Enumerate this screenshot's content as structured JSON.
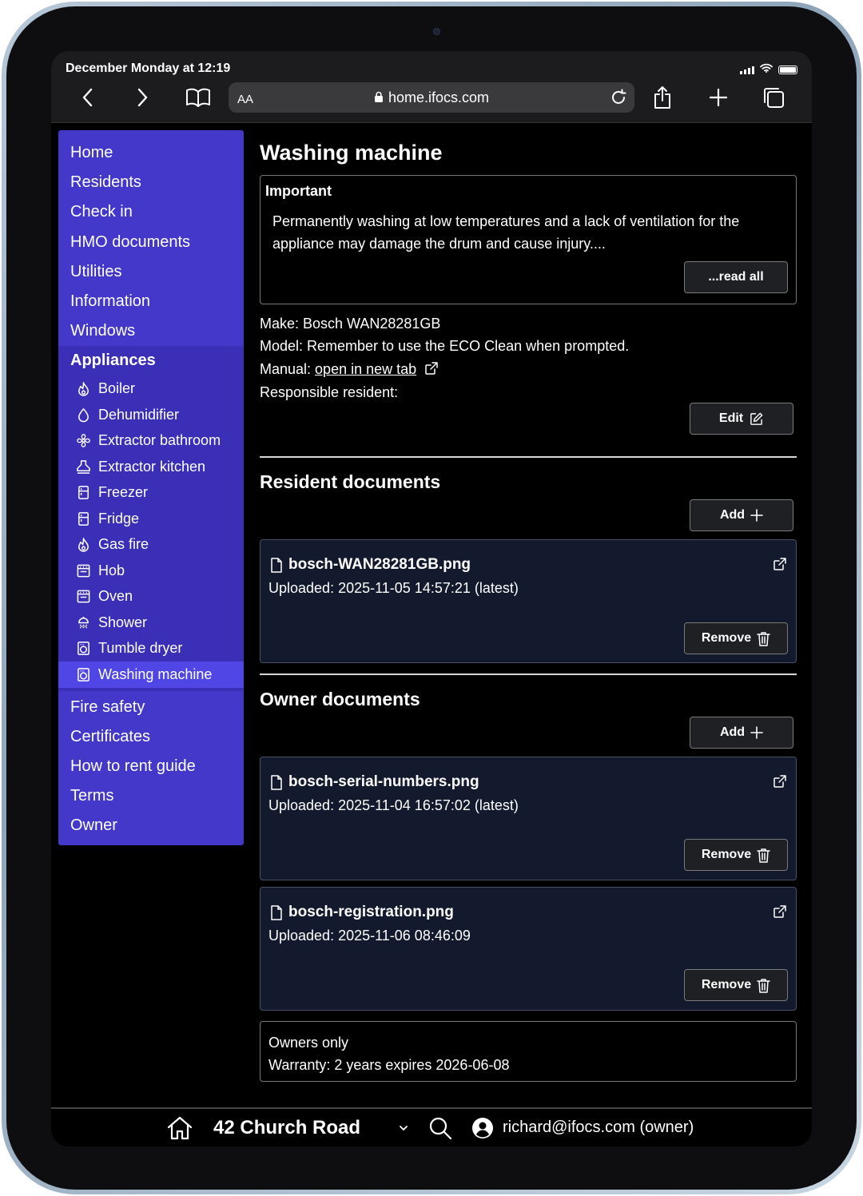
{
  "status": {
    "time": "December Monday at 12:19"
  },
  "browser": {
    "aa_label": "AA",
    "url": "home.ifocs.com"
  },
  "sidebar": {
    "top_items": [
      "Home",
      "Residents",
      "Check in",
      "HMO documents",
      "Utilities",
      "Information",
      "Windows"
    ],
    "section_label": "Appliances",
    "sub_items": [
      {
        "label": "Boiler",
        "icon": "flame-icon"
      },
      {
        "label": "Dehumidifier",
        "icon": "droplet-icon"
      },
      {
        "label": "Extractor bathroom",
        "icon": "fan-icon"
      },
      {
        "label": "Extractor kitchen",
        "icon": "cooker-hood-icon"
      },
      {
        "label": "Freezer",
        "icon": "refrigerator-icon"
      },
      {
        "label": "Fridge",
        "icon": "refrigerator-icon"
      },
      {
        "label": "Gas fire",
        "icon": "flame-icon"
      },
      {
        "label": "Hob",
        "icon": "oven-icon"
      },
      {
        "label": "Oven",
        "icon": "oven-icon"
      },
      {
        "label": "Shower",
        "icon": "shower-icon"
      },
      {
        "label": "Tumble dryer",
        "icon": "washing-machine-icon"
      },
      {
        "label": "Washing machine",
        "icon": "washing-machine-icon"
      }
    ],
    "active_item": "Washing machine",
    "bottom_items": [
      "Fire safety",
      "Certificates",
      "How to rent guide",
      "Terms",
      "Owner"
    ]
  },
  "page": {
    "title": "Washing machine",
    "important": {
      "title": "Important",
      "text": "Permanently washing at low temperatures and a lack of ventilation for the appliance may damage the drum and cause injury....",
      "read_all_label": "...read all"
    },
    "make_label": "Make: Bosch WAN28281GB",
    "model_label": "Model: Remember to use the ECO Clean when prompted.",
    "manual_prefix": "Manual: ",
    "manual_link": "open in new tab",
    "responsible_label": "Responsible resident:",
    "edit_label": "Edit"
  },
  "resident_documents": {
    "title": "Resident documents",
    "add_label": "Add",
    "items": [
      {
        "name": "bosch-WAN28281GB.png",
        "uploaded": "Uploaded: 2025-11-05 14:57:21 (latest)",
        "remove_label": "Remove"
      }
    ]
  },
  "owner_documents": {
    "title": "Owner documents",
    "add_label": "Add",
    "items": [
      {
        "name": "bosch-serial-numbers.png",
        "uploaded": "Uploaded: 2025-11-04 16:57:02 (latest)",
        "remove_label": "Remove"
      },
      {
        "name": "bosch-registration.png",
        "uploaded": "Uploaded: 2025-11-06 08:46:09",
        "remove_label": "Remove"
      }
    ]
  },
  "owners_only": {
    "title": "Owners only",
    "warranty": "Warranty: 2 years expires 2026-06-08"
  },
  "bottom_bar": {
    "property": "42 Church Road",
    "user": "richard@ifocs.com (owner)"
  },
  "colors": {
    "sidebar": "#4338ca",
    "sidebar_section": "#3a2fb6",
    "active": "#4f46e5",
    "doc_card": "#131a2e"
  }
}
